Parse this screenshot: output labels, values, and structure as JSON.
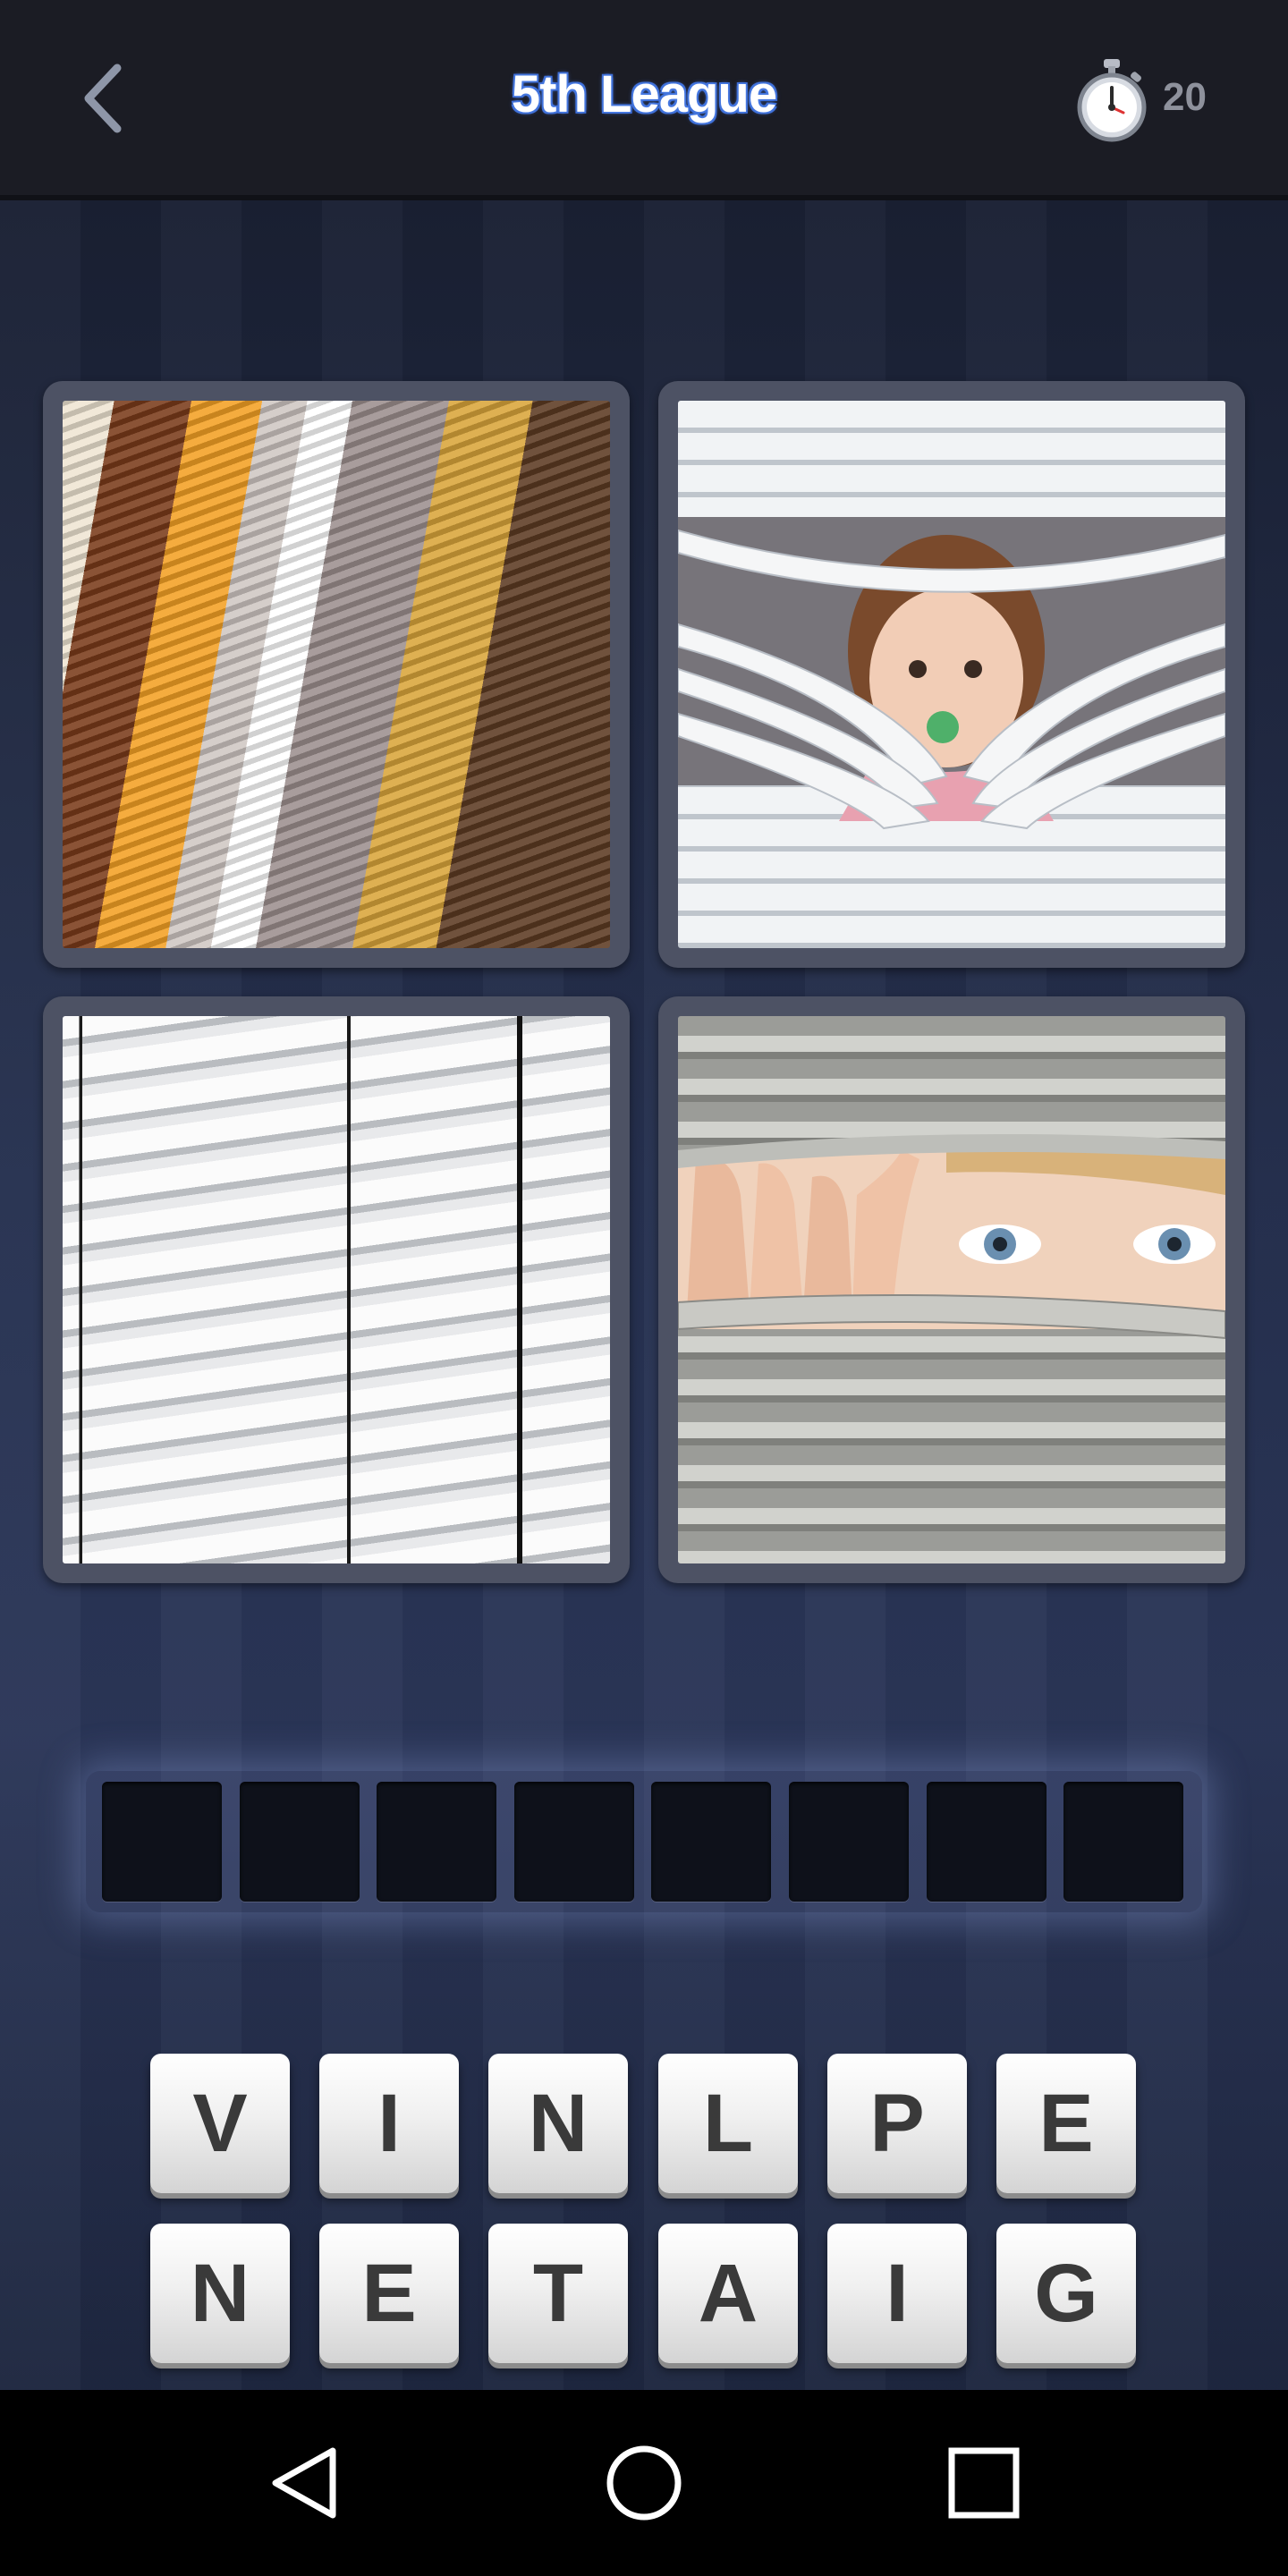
{
  "header": {
    "title": "5th League",
    "coins": "20"
  },
  "icons": {
    "back": "chevron-left-icon",
    "timer": "stopwatch-icon",
    "nav_back": "triangle-back-icon",
    "nav_home": "circle-home-icon",
    "nav_recents": "square-recents-icon"
  },
  "pictures": [
    {
      "subject": "pleated-blinds"
    },
    {
      "subject": "child-peeking-through-blinds"
    },
    {
      "subject": "white-venetian-blinds"
    },
    {
      "subject": "woman-peeking-through-blinds"
    }
  ],
  "answer_slots": [
    "",
    "",
    "",
    "",
    "",
    "",
    "",
    ""
  ],
  "letters_row1": [
    "V",
    "I",
    "N",
    "L",
    "P",
    "E"
  ],
  "letters_row2": [
    "N",
    "E",
    "T",
    "A",
    "I",
    "G"
  ],
  "colors": {
    "accent": "#3b6bd3",
    "topbar": "#1b1c24",
    "background": "#263150",
    "slot": "#0e111a",
    "key": "#f0f0f0"
  }
}
